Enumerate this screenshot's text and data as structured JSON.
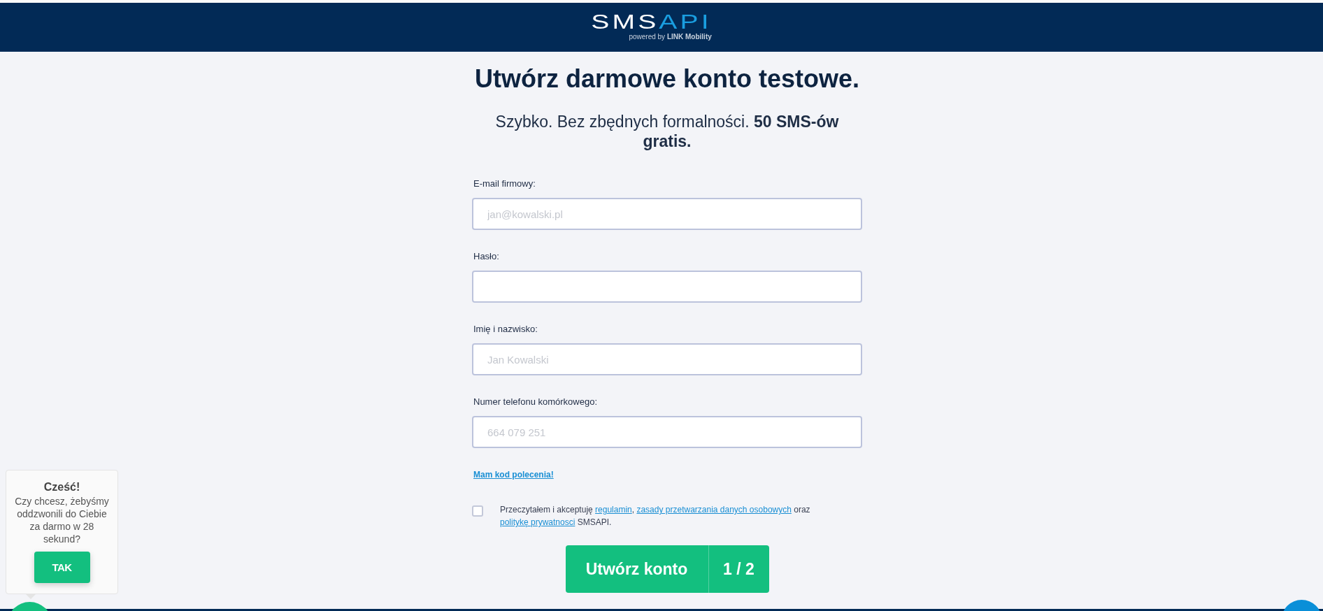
{
  "header": {
    "logo": {
      "primary": "SMS",
      "accent": "API",
      "tagline": "powered by **LINK Mobility**"
    }
  },
  "form": {
    "title": "Utwórz darmowe konto testowe.",
    "subtitle": "Szybko. Bez zbędnych formalności. **50 SMS-ów gratis.**",
    "fields": [
      {
        "label": "E-mail firmowy:",
        "placeholder": "jan@kowalski.pl"
      },
      {
        "label": "Hasło:"
      },
      {
        "label": "Imię i nazwisko:",
        "placeholder": "Jan Kowalski"
      },
      {
        "label": "Numer telefonu komórkowego:",
        "placeholder": "664 079 251"
      }
    ],
    "referral_link": "Mam kod polecenia!",
    "consent": {
      "checked": false,
      "parts": [
        {
          "kind": "text",
          "text": "Przeczytałem i akceptuję "
        },
        {
          "kind": "link",
          "text": "regulamin"
        },
        {
          "kind": "text",
          "text": ", "
        },
        {
          "kind": "link",
          "text": "zasady przetwarzania danych osobowych"
        },
        {
          "kind": "text",
          "text": " oraz "
        },
        {
          "kind": "link",
          "text": "politykę prywatnosci"
        },
        {
          "kind": "text",
          "text": " SMSAPI."
        }
      ]
    },
    "submit": {
      "label": "Utwórz konto",
      "step": "1 / 2"
    }
  },
  "callback_popup": {
    "title": "Cześć!",
    "message": "Czy chcesz, żebyśmy oddzwonili do Ciebie za darmo w 28 sekund?",
    "button": "TAK"
  }
}
